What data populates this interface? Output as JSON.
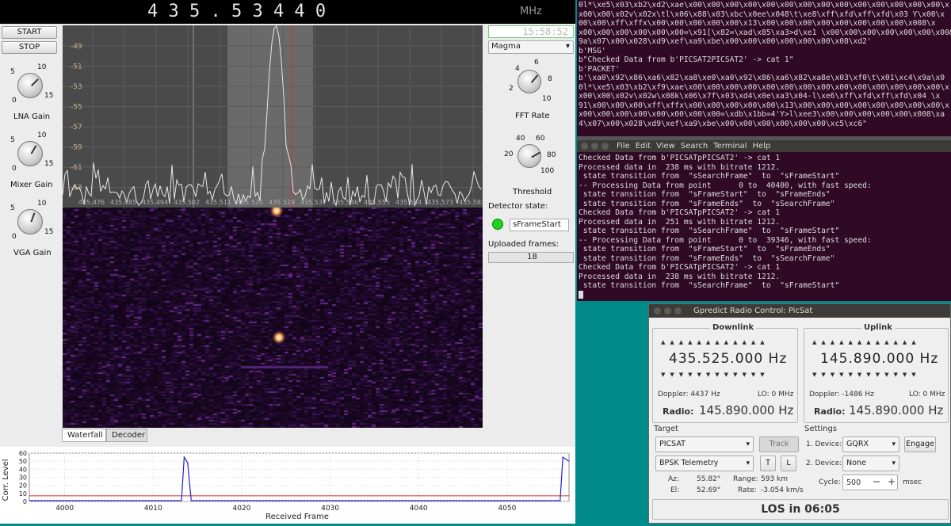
{
  "sdr": {
    "freq_digits": "4 3 5 . 5 3 4 4 0",
    "freq_unit": "MHz",
    "start_label": "START",
    "stop_label": "STOP",
    "knobs": [
      {
        "label": "LNA Gain",
        "ticks": [
          "5",
          "10",
          "0",
          "15"
        ]
      },
      {
        "label": "Mixer Gain",
        "ticks": [
          "5",
          "10",
          "0",
          "15"
        ]
      },
      {
        "label": "VGA Gain",
        "ticks": [
          "5",
          "10",
          "0",
          "15"
        ]
      }
    ],
    "clock": "15:58:52",
    "colormap": "Magma",
    "fft_rate": {
      "label": "FFT Rate",
      "ticks": [
        "4",
        "6",
        "2",
        "8",
        "10"
      ]
    },
    "threshold": {
      "label": "Threshold",
      "ticks": [
        "40",
        "60",
        "20",
        "80",
        "100"
      ]
    },
    "detector_state_label": "Detector state:",
    "detector_state_value": "sFrameStart",
    "uploaded_frames_label": "Uploaded frames:",
    "uploaded_frames_value": "18",
    "tabs": [
      "Waterfall",
      "Decoder"
    ],
    "spectrum_y_ticks": [
      "-49",
      "-51",
      "-53",
      "-55",
      "-57",
      "-59",
      "-61",
      "-63"
    ],
    "spectrum_x_ticks": [
      "435.476",
      "435.485",
      "435.494",
      "435.502",
      "435.511",
      "435.520",
      "435.529",
      "435.537",
      "435.546",
      "435.555",
      "435.564",
      "435.573",
      "435.581"
    ]
  },
  "chart_data": {
    "type": "line",
    "title": "",
    "xlabel": "Received Frame",
    "ylabel": "Corr. Level",
    "xlim": [
      3996,
      4057
    ],
    "ylim": [
      0,
      60
    ],
    "x_ticks": [
      "4000",
      "4010",
      "4020",
      "4030",
      "4040",
      "4050"
    ],
    "y_ticks": [
      "0",
      "10",
      "20",
      "30",
      "40",
      "50",
      "60"
    ],
    "threshold": 7,
    "series": [
      {
        "x": [
          3996,
          4013.2,
          4013.5,
          4013.9,
          4014.3,
          4056,
          4056.3,
          4057
        ],
        "y": [
          1,
          1,
          55,
          48,
          1,
          1,
          55,
          50
        ]
      }
    ]
  },
  "terminal1": {
    "lines": [
      "0l*\\xe5\\x03\\xb2\\xd2\\xae\\x00\\x00\\x00\\x00\\x00\\x00\\x00\\x00\\x00\\x00\\x00\\x00\\x00\\x00\\x",
      "x00\\x00\\x02v\\x02x\\tl\\x06\\x88\\x03\\xbc\\x0ee\\x048\\t\\xe8\\xff\\xfd\\xff\\xfd\\x03 Y\\x00\\x",
      "00\\x00\\xff\\xffx\\x00\\x00\\x00\\x00\\x00\\x13\\x00\\x00\\x00\\x00\\x00\\x00\\x00\\x00\\x008\\x",
      "x00\\x00\\x00\\x00\\x00\\x00=\\x91[\\x82=\\xad\\x85\\xa3>d\\xe1 \\x00\\x00\\x00\\x00\\x00\\x00\\x00&\\x",
      "9a\\x07\\x00\\x028\\xd9\\xef\\xa9\\xbe\\x00\\x00\\x00\\x00\\x00\\x00\\x08\\xd2'",
      "b'MSG'",
      "b\"Checked Data from b'PICSAT2PICSAT2' -> cat 1\"",
      "b'PACKET'",
      "b'\\xa0\\x92\\x86\\xa6\\x82\\xa8\\xe0\\xa0\\x92\\x86\\xa6\\x82\\xa8e\\x03\\xf0\\t\\x01\\xc4\\x9a\\x0",
      "0l*\\xe5\\x03\\xb2\\xf9\\xae\\x00\\x00\\x00\\x00\\x00\\x00\\x00\\x00\\x00\\x00\\x00\\x00\\x00\\x00\\x",
      "x00\\x00\\x02v\\x02w\\x08k\\x06\\x7f\\x03\\xd4\\x0e\\xa3\\x04-l\\xe6\\xff\\xfd\\xff\\xfd\\x04 \\x",
      "91\\x00\\x00\\x00\\xff\\xffx\\x00\\x00\\x00\\x00\\x00\\x13\\x00\\x00\\x00\\x00\\x00\\x00\\x00\\x00\\x",
      "x00\\x00\\x00\\x00\\x00\\x00\\x00\\x00=\\xdb\\x1bb=4'Y>l\\xee3\\x00\\x00\\x00\\x00\\x00\\x008\\xa",
      "4\\x07\\x00\\x028\\xd9\\xef\\xa9\\xbe\\x00\\x00\\x00\\x00\\x00\\x00\\xc5\\xc6\""
    ]
  },
  "terminal2": {
    "menu": [
      "File",
      "Edit",
      "View",
      "Search",
      "Terminal",
      "Help"
    ],
    "lines": [
      "Checked Data from b'PICSATpPICSAT2' -> cat 1",
      "Processed data in  238 ms with bitrate 1212.",
      " state transition from  \"sSearchFrame\"  to  \"sFrameStart\"",
      "-- Processing Data from point      0 to  40400, with fast speed:",
      " state transition from  \"sFrameStart\"  to  \"sFrameEnds\"",
      " state transition from  \"sFrameEnds\"  to  \"sSearchFrame\"",
      "Checked Data from b'PICSATpPICSAT2' -> cat 1",
      "Processed data in  251 ms with bitrate 1212.",
      " state transition from  \"sSearchFrame\"  to  \"sFrameStart\"",
      "-- Processing Data from point      0 to  39346, with fast speed:",
      " state transition from  \"sFrameStart\"  to  \"sFrameEnds\"",
      " state transition from  \"sFrameEnds\"  to  \"sSearchFrame\"",
      "Checked Data from b'PICSATpPICSAT2' -> cat 1",
      "Processed data in  238 ms with bitrate 1212.",
      " state transition from  \"sSearchFrame\"  to  \"sFrameStart\""
    ]
  },
  "gpredict": {
    "title": "Gpredict Radio Control: PicSat",
    "downlink": {
      "label": "Downlink",
      "freq": "435.525.000 Hz",
      "doppler": "Doppler: 4437 Hz",
      "lo": "LO: 0 MHz",
      "radio_label": "Radio:",
      "radio_value": "145.890.000 Hz"
    },
    "uplink": {
      "label": "Uplink",
      "freq": "145.890.000 Hz",
      "doppler": "Doppler: -1486 Hz",
      "lo": "LO: 0 MHz",
      "radio_label": "Radio:",
      "radio_value": "145.890.000 Hz"
    },
    "target": {
      "label": "Target",
      "satellite": "PICSAT",
      "track": "Track",
      "mode": "BPSK Telemetry",
      "t": "T",
      "l": "L",
      "az_label": "Az:",
      "az": "55.82°",
      "el_label": "El:",
      "el": "52.69°",
      "range_label": "Range:",
      "range": "593 km",
      "rate_label": "Rate:",
      "rate": "-3.054 km/s"
    },
    "settings": {
      "label": "Settings",
      "dev1_label": "1. Device:",
      "dev1": "GQRX",
      "engage": "Engage",
      "dev2_label": "2. Device:",
      "dev2": "None",
      "cycle_label": "Cycle:",
      "cycle": "500",
      "cycle_unit": "msec",
      "minus": "−",
      "plus": "+"
    },
    "los": "LOS in 06:05"
  }
}
